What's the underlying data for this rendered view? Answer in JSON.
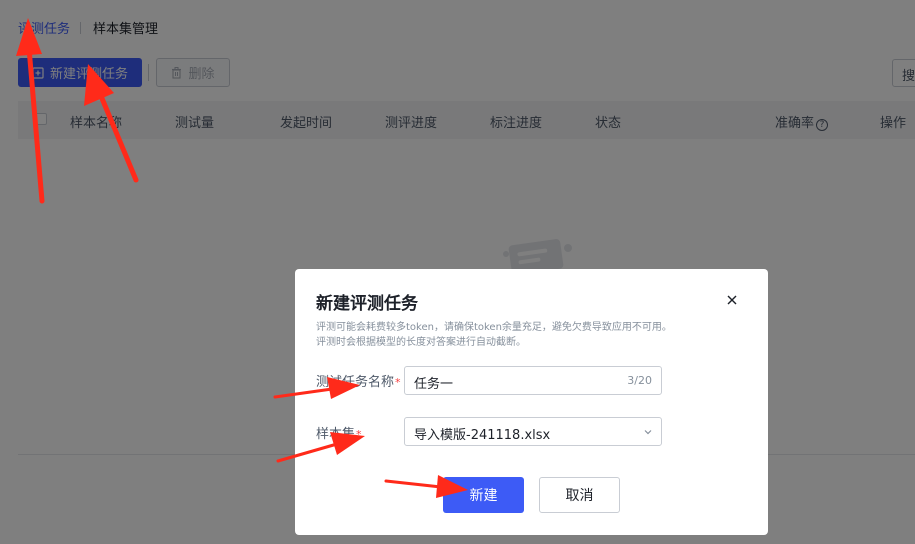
{
  "tabs": {
    "eval_tasks": "评测任务",
    "sample_sets": "样本集管理"
  },
  "toolbar": {
    "new_task_label": "新建评测任务",
    "delete_label": "删除",
    "search_placeholder": "搜"
  },
  "table": {
    "columns": [
      "样本名称",
      "测试量",
      "发起时间",
      "测评进度",
      "标注进度",
      "状态",
      "准确率",
      "操作"
    ]
  },
  "modal": {
    "title": "新建评测任务",
    "description_line1": "评测可能会耗费较多token，请确保token余量充足，避免欠费导致应用不可用。",
    "description_line2": "评测时会根据模型的长度对答案进行自动截断。",
    "task_name_label": "测试任务名称",
    "task_name_value": "任务一",
    "task_name_count": "3/20",
    "sample_set_label": "样本集",
    "sample_set_value": "导入模版-241118.xlsx",
    "required_mark": "*",
    "create_label": "新建",
    "cancel_label": "取消"
  },
  "colors": {
    "primary": "#3d5bf6",
    "annotation_arrow": "#ff2a1a",
    "overlay": "rgba(0,0,0,0.5)"
  },
  "icons": {
    "new_task": "add-task-icon",
    "delete": "trash-icon",
    "accuracy_info": "question-circle-icon",
    "modal_close": "close-icon",
    "select": "chevron-down-icon"
  }
}
